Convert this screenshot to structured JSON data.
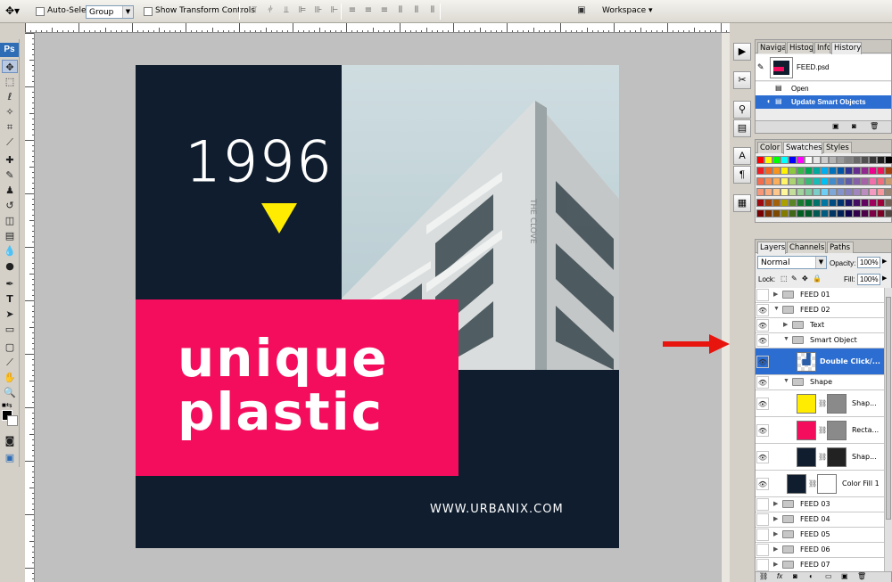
{
  "options_bar": {
    "auto_select_label": "Auto-Select:",
    "auto_select_value": "Group",
    "show_transform_label": "Show Transform Controls",
    "workspace_label": "Workspace ▾"
  },
  "toolbox": {
    "logo": "Ps"
  },
  "artwork": {
    "year": "1996",
    "line1": "unique",
    "line2": "plastic",
    "url": "WWW.URBANIX.COM",
    "building_sign": "THE CLOVE",
    "colors": {
      "navy": "#0f1d2e",
      "pink": "#f40d5c",
      "yellow": "#ffec00"
    }
  },
  "history_panel": {
    "tabs": [
      "Naviga",
      "Histog",
      "Info",
      "History"
    ],
    "active_tab": "History",
    "snapshot_name": "FEED.psd",
    "states": [
      "Open",
      "Update Smart Objects"
    ],
    "selected_state": "Update Smart Objects"
  },
  "color_panel": {
    "tabs": [
      "Color",
      "Swatches",
      "Styles"
    ],
    "active_tab": "Swatches"
  },
  "layers_panel": {
    "tabs": [
      "Layers",
      "Channels",
      "Paths"
    ],
    "active_tab": "Layers",
    "blend_mode": "Normal",
    "opacity_label": "Opacity:",
    "opacity_value": "100%",
    "lock_label": "Lock:",
    "fill_label": "Fill:",
    "fill_value": "100%",
    "layers": [
      {
        "name": "FEED 01",
        "type": "group",
        "indent": 0,
        "expanded": false,
        "visible": false
      },
      {
        "name": "FEED 02",
        "type": "group",
        "indent": 0,
        "expanded": true,
        "visible": true
      },
      {
        "name": "Text",
        "type": "group",
        "indent": 1,
        "expanded": false,
        "visible": true
      },
      {
        "name": "Smart Object",
        "type": "group",
        "indent": 1,
        "expanded": true,
        "visible": true
      },
      {
        "name": "Double Click/...",
        "type": "smart",
        "indent": 2,
        "visible": true,
        "selected": true
      },
      {
        "name": "Shape",
        "type": "group",
        "indent": 1,
        "expanded": true,
        "visible": true
      },
      {
        "name": "Shap...",
        "type": "shape",
        "indent": 2,
        "visible": true,
        "color": "#ffec00"
      },
      {
        "name": "Recta...",
        "type": "shape",
        "indent": 2,
        "visible": true,
        "color": "#f40d5c"
      },
      {
        "name": "Shap...",
        "type": "shape",
        "indent": 2,
        "visible": true,
        "color": "#0f1d2e"
      },
      {
        "name": "Color Fill 1",
        "type": "fill",
        "indent": 1,
        "visible": true,
        "color": "#0f1d2e"
      },
      {
        "name": "FEED 03",
        "type": "group",
        "indent": 0,
        "expanded": false,
        "visible": false
      },
      {
        "name": "FEED 04",
        "type": "group",
        "indent": 0,
        "expanded": false,
        "visible": false
      },
      {
        "name": "FEED 05",
        "type": "group",
        "indent": 0,
        "expanded": false,
        "visible": false
      },
      {
        "name": "FEED 06",
        "type": "group",
        "indent": 0,
        "expanded": false,
        "visible": false
      },
      {
        "name": "FEED 07",
        "type": "group",
        "indent": 0,
        "expanded": false,
        "visible": false
      }
    ]
  },
  "annotation": {
    "arrow_color": "#e8150f"
  }
}
